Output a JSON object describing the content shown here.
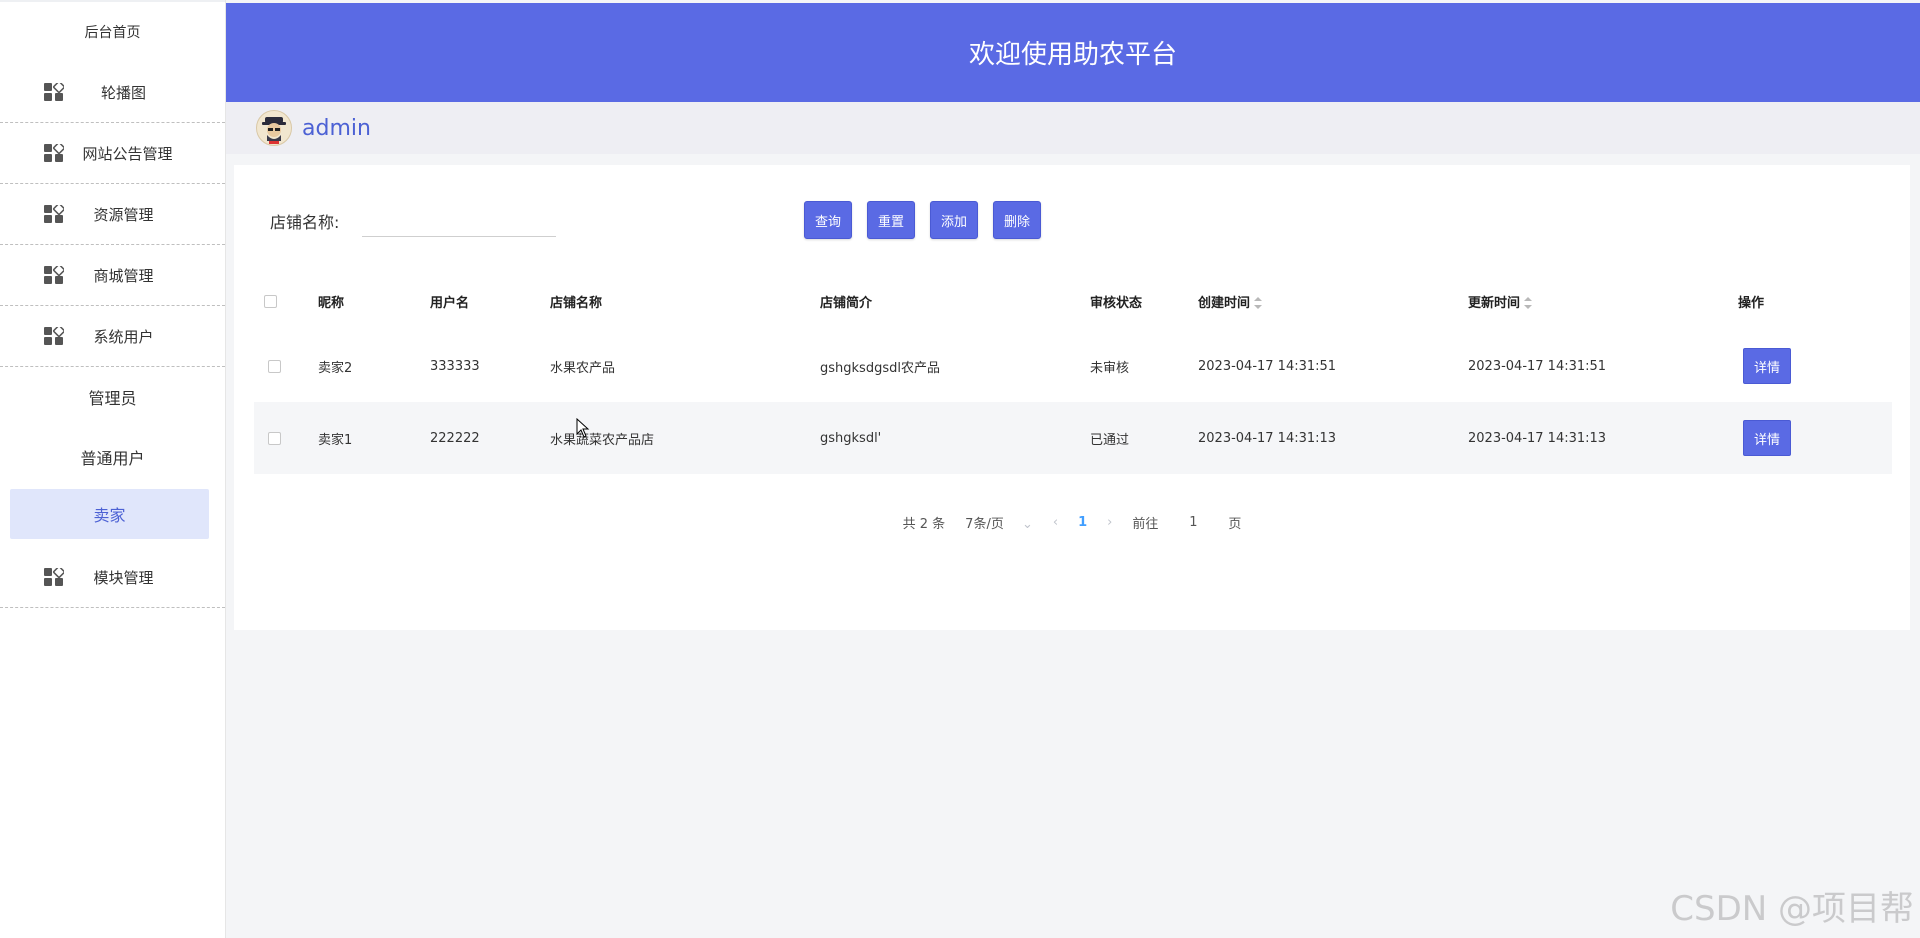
{
  "sidebar": {
    "home": "后台首页",
    "items": [
      {
        "label": "轮播图",
        "icon": "grid-icon"
      },
      {
        "label": "网站公告管理",
        "icon": "grid-icon"
      },
      {
        "label": "资源管理",
        "icon": "grid-icon"
      },
      {
        "label": "商城管理",
        "icon": "grid-icon"
      },
      {
        "label": "系统用户",
        "icon": "grid-icon"
      }
    ],
    "sub_items": [
      "管理员",
      "普通用户",
      "卖家"
    ],
    "active_sub": "卖家",
    "last_item": {
      "label": "模块管理",
      "icon": "grid-icon"
    }
  },
  "header": {
    "title": "欢迎使用助农平台"
  },
  "userbar": {
    "username": "admin"
  },
  "filter": {
    "label": "店铺名称:",
    "value": "",
    "buttons": {
      "search": "查询",
      "reset": "重置",
      "add": "添加",
      "delete": "删除"
    }
  },
  "table": {
    "headers": [
      "昵称",
      "用户名",
      "店铺名称",
      "店铺简介",
      "审核状态",
      "创建时间",
      "更新时间",
      "操作"
    ],
    "rows": [
      {
        "nickname": "卖家2",
        "username": "333333",
        "shop_name": "水果农产品",
        "intro": "gshgksdgsdl农产品",
        "status": "未审核",
        "created": "2023-04-17 14:31:51",
        "updated": "2023-04-17 14:31:51",
        "action": "详情"
      },
      {
        "nickname": "卖家1",
        "username": "222222",
        "shop_name": "水果蔬菜农产品店",
        "intro": "gshgksdl'",
        "status": "已通过",
        "created": "2023-04-17 14:31:13",
        "updated": "2023-04-17 14:31:13",
        "action": "详情"
      }
    ]
  },
  "pagination": {
    "total_text": "共 2 条",
    "page_size": "7条/页",
    "current_page": "1",
    "goto_label": "前往",
    "goto_value": "1",
    "page_suffix": "页"
  },
  "watermark": "CSDN @项目帮",
  "colors": {
    "accent": "#5a6ae4",
    "active_bg": "#e0e6fb",
    "link": "#409eff"
  }
}
